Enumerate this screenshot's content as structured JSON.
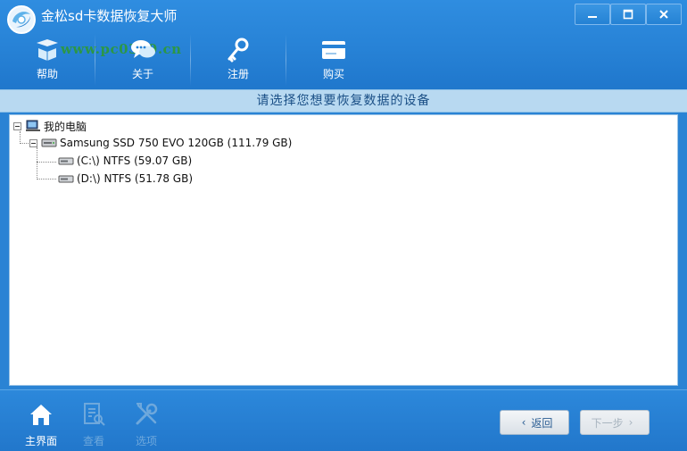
{
  "window": {
    "title": "金松sd卡数据恢复大师",
    "watermark": "www.pc0359.cn"
  },
  "toolbar": {
    "items": [
      {
        "label": "帮助",
        "icon": "help-icon"
      },
      {
        "label": "关于",
        "icon": "about-chat-icon"
      },
      {
        "label": "注册",
        "icon": "key-icon"
      },
      {
        "label": "购买",
        "icon": "buy-card-icon"
      }
    ]
  },
  "banner": {
    "text": "请选择您想要恢复数据的设备"
  },
  "tree": {
    "root": {
      "label": "我的电脑",
      "icon": "computer-icon"
    },
    "disk": {
      "label": "Samsung SSD 750 EVO 120GB (111.79 GB)",
      "icon": "hard-disk-icon"
    },
    "partitions": [
      {
        "label": "(C:\\) NTFS (59.07 GB)",
        "icon": "drive-icon"
      },
      {
        "label": "(D:\\) NTFS (51.78 GB)",
        "icon": "drive-icon"
      }
    ]
  },
  "footer": {
    "nav": [
      {
        "label": "主界面",
        "icon": "home-icon",
        "state": "active"
      },
      {
        "label": "查看",
        "icon": "view-document-icon",
        "state": "disabled"
      },
      {
        "label": "选项",
        "icon": "tools-icon",
        "state": "disabled"
      }
    ],
    "back_label": "返回",
    "next_label": "下一步"
  },
  "colors": {
    "header_blue": "#2782d6",
    "banner_bg": "#b8d9f1",
    "banner_text": "#1a4f86"
  }
}
